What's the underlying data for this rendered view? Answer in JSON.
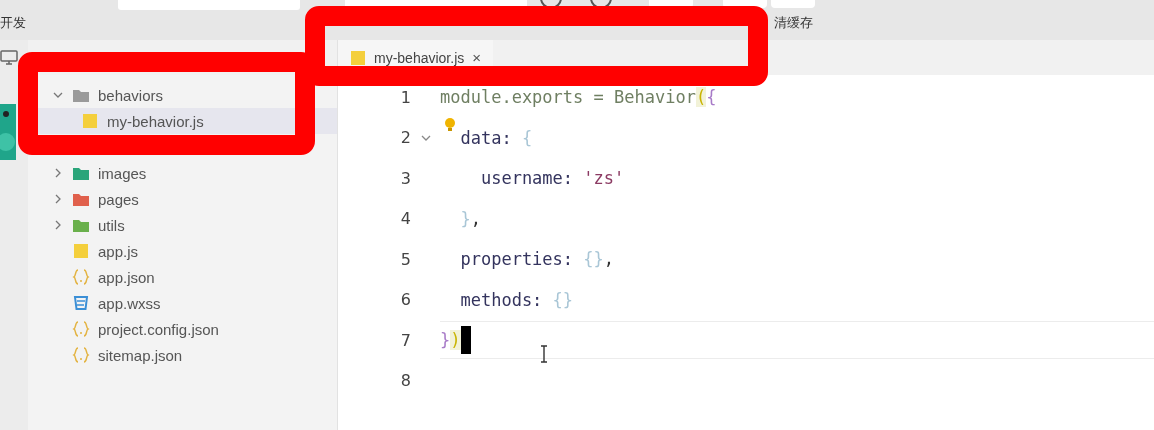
{
  "toolbar": {
    "labels": [
      {
        "text": "开发"
      },
      {
        "text": "清缓存"
      }
    ]
  },
  "explorer": {
    "items": [
      {
        "name": "behaviors",
        "kind": "folder",
        "color": "#9a9a9a",
        "expanded": true,
        "children": [
          {
            "name": "my-behavior.js",
            "kind": "js",
            "selected": true
          }
        ]
      },
      {
        "name": "images",
        "kind": "folder",
        "color": "#2aa57a",
        "expanded": false
      },
      {
        "name": "pages",
        "kind": "folder",
        "color": "#e0604c",
        "expanded": false
      },
      {
        "name": "utils",
        "kind": "folder",
        "color": "#6ab04c",
        "expanded": false
      },
      {
        "name": "app.js",
        "kind": "js",
        "selected": false
      },
      {
        "name": "app.json",
        "kind": "json",
        "selected": false
      },
      {
        "name": "app.wxss",
        "kind": "wxss",
        "selected": false
      },
      {
        "name": "project.config.json",
        "kind": "json",
        "selected": false
      },
      {
        "name": "sitemap.json",
        "kind": "json",
        "selected": false
      }
    ]
  },
  "editor": {
    "tabs": [
      {
        "label": "my-behavior.js",
        "close": "×",
        "selected": true
      }
    ],
    "lines": [
      {
        "number": "1",
        "fold_open": false,
        "current": false,
        "tokens": [
          {
            "text": "module.exports = Behavior",
            "kind": "ident"
          },
          {
            "text": "(",
            "kind": "match"
          },
          {
            "text": "{",
            "kind": "brace2"
          }
        ]
      },
      {
        "number": "2",
        "fold_open": true,
        "current": false,
        "tokens": [
          {
            "text": "  data: ",
            "kind": "key"
          },
          {
            "text": "{",
            "kind": "brace"
          }
        ]
      },
      {
        "number": "3",
        "fold_open": false,
        "current": false,
        "tokens": [
          {
            "text": "    username: ",
            "kind": "key"
          },
          {
            "text": "'zs'",
            "kind": "string"
          }
        ]
      },
      {
        "number": "4",
        "fold_open": false,
        "current": false,
        "tokens": [
          {
            "text": "  }",
            "kind": "brace"
          },
          {
            "text": ",",
            "kind": "punct"
          }
        ]
      },
      {
        "number": "5",
        "fold_open": false,
        "current": false,
        "tokens": [
          {
            "text": "  properties: ",
            "kind": "key"
          },
          {
            "text": "{}",
            "kind": "brace"
          },
          {
            "text": ",",
            "kind": "punct"
          }
        ]
      },
      {
        "number": "6",
        "fold_open": false,
        "current": false,
        "tokens": [
          {
            "text": "  methods: ",
            "kind": "key"
          },
          {
            "text": "{}",
            "kind": "brace"
          }
        ]
      },
      {
        "number": "7",
        "fold_open": false,
        "current": true,
        "tokens": [
          {
            "text": "}",
            "kind": "brace2"
          },
          {
            "text": ")",
            "kind": "match"
          }
        ]
      },
      {
        "number": "8",
        "fold_open": false,
        "current": false
      }
    ]
  }
}
